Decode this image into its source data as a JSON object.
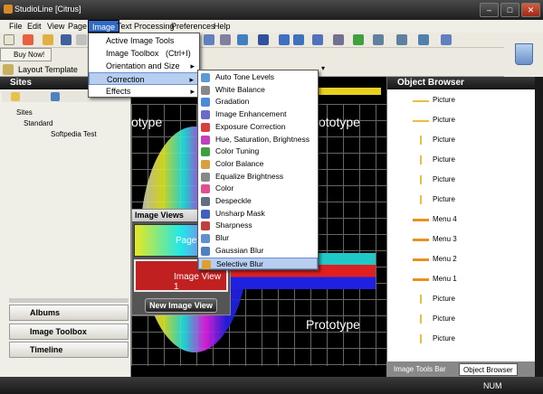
{
  "window": {
    "title": "StudioLine [Citrus]",
    "buttons": [
      "–",
      "□",
      "✕"
    ]
  },
  "menubar": [
    "File",
    "Edit",
    "View",
    "Page",
    "Image",
    "Text Processing",
    "Preferences",
    "Help"
  ],
  "toolbar": {
    "layout_template": "Layout Template",
    "buy_now": "Buy Now!"
  },
  "image_menu": [
    {
      "label": "Active Image Tools"
    },
    {
      "label": "Image Toolbox",
      "shortcut": "(Ctrl+I)"
    },
    {
      "label": "Orientation and Size"
    },
    {
      "label": "Correction"
    },
    {
      "label": "Effects"
    }
  ],
  "correction_submenu": [
    {
      "label": "Auto Tone Levels",
      "color": "#5a9ad8"
    },
    {
      "label": "White Balance",
      "color": "#888888"
    },
    {
      "label": "Gradation",
      "color": "#4a8ad8"
    },
    {
      "label": "Image Enhancement",
      "color": "#6a6ac8"
    },
    {
      "label": "Exposure Correction",
      "color": "#d84040"
    },
    {
      "label": "Hue, Saturation, Brightness",
      "color": "#c040c0"
    },
    {
      "label": "Color Tuning",
      "color": "#40a040"
    },
    {
      "label": "Color Balance",
      "color": "#d8a040"
    },
    {
      "label": "Equalize Brightness",
      "color": "#888888"
    },
    {
      "label": "Color",
      "color": "#e05090"
    },
    {
      "label": "Despeckle",
      "color": "#607080"
    },
    {
      "label": "Unsharp Mask",
      "color": "#4060c0"
    },
    {
      "label": "Sharpness",
      "color": "#c04040"
    },
    {
      "label": "Blur",
      "color": "#6090d0"
    },
    {
      "label": "Gaussian Blur",
      "color": "#5080c0"
    },
    {
      "label": "Selective Blur",
      "color": "#e0a030"
    }
  ],
  "left_panel": {
    "title": "Sites",
    "tree": [
      "Sites",
      "Standard",
      "Softpedia Test"
    ],
    "buttons": [
      "Albums",
      "Image Toolbox",
      "Timeline"
    ]
  },
  "center": {
    "image_views_title": "Image Views",
    "views": [
      "Page",
      "Image View 1"
    ],
    "new_view_button": "New Image View",
    "prototype_labels": [
      "otype",
      "Prototype",
      "Prototype"
    ]
  },
  "right_panel": {
    "title": "Object Browser",
    "items": [
      "Picture",
      "Picture",
      "Picture",
      "Picture",
      "Picture",
      "Picture",
      "Menu 4",
      "Menu 3",
      "Menu 2",
      "Menu 1",
      "Picture",
      "Picture",
      "Picture"
    ],
    "tabs": [
      "Image Tools Bar",
      "Object Browser"
    ]
  },
  "status": {
    "num": "NUM"
  }
}
